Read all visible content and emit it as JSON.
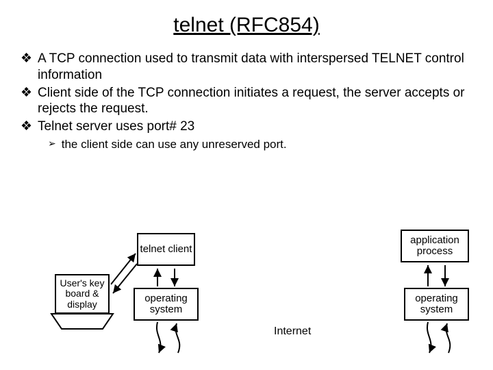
{
  "title": "telnet (RFC854)",
  "bullets": {
    "b1": "A TCP connection used to transmit data with interspersed TELNET control information",
    "b2": "Client side of the TCP connection initiates a request, the server accepts or rejects the request.",
    "b3": "Telnet server uses port# 23",
    "sub1": "the client side can use any unreserved port."
  },
  "diagram": {
    "user_box": "User's key board & display",
    "telnet_client": "telnet client",
    "os_left": "operating system",
    "app_process": "application process",
    "os_right": "operating system",
    "internet": "Internet"
  }
}
